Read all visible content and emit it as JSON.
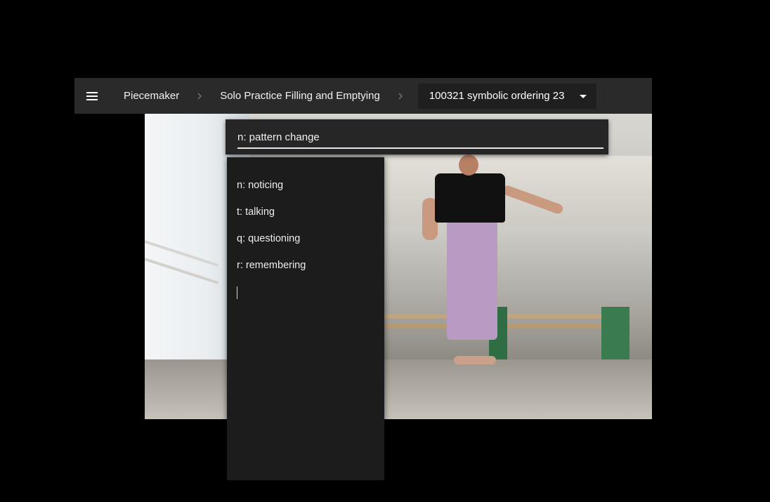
{
  "header": {
    "menu_icon": "hamburger-menu-icon",
    "app_name": "Piecemaker",
    "separator_icon": "chevron-right-icon",
    "project_title": "Solo Practice Filling and Emptying",
    "video_title": "100321 symbolic ordering 23",
    "dropdown_icon": "caret-down-icon"
  },
  "annotation": {
    "input_value": "n: pattern change",
    "suggestions": [
      {
        "label": "n: noticing"
      },
      {
        "label": "t: talking"
      },
      {
        "label": "q: questioning"
      },
      {
        "label": "r: remembering"
      }
    ]
  },
  "colors": {
    "background": "#000000",
    "topbar": "#2a2a2a",
    "panel": "#1c1c1c",
    "text": "#f2f2f2",
    "separator": "#777777"
  }
}
